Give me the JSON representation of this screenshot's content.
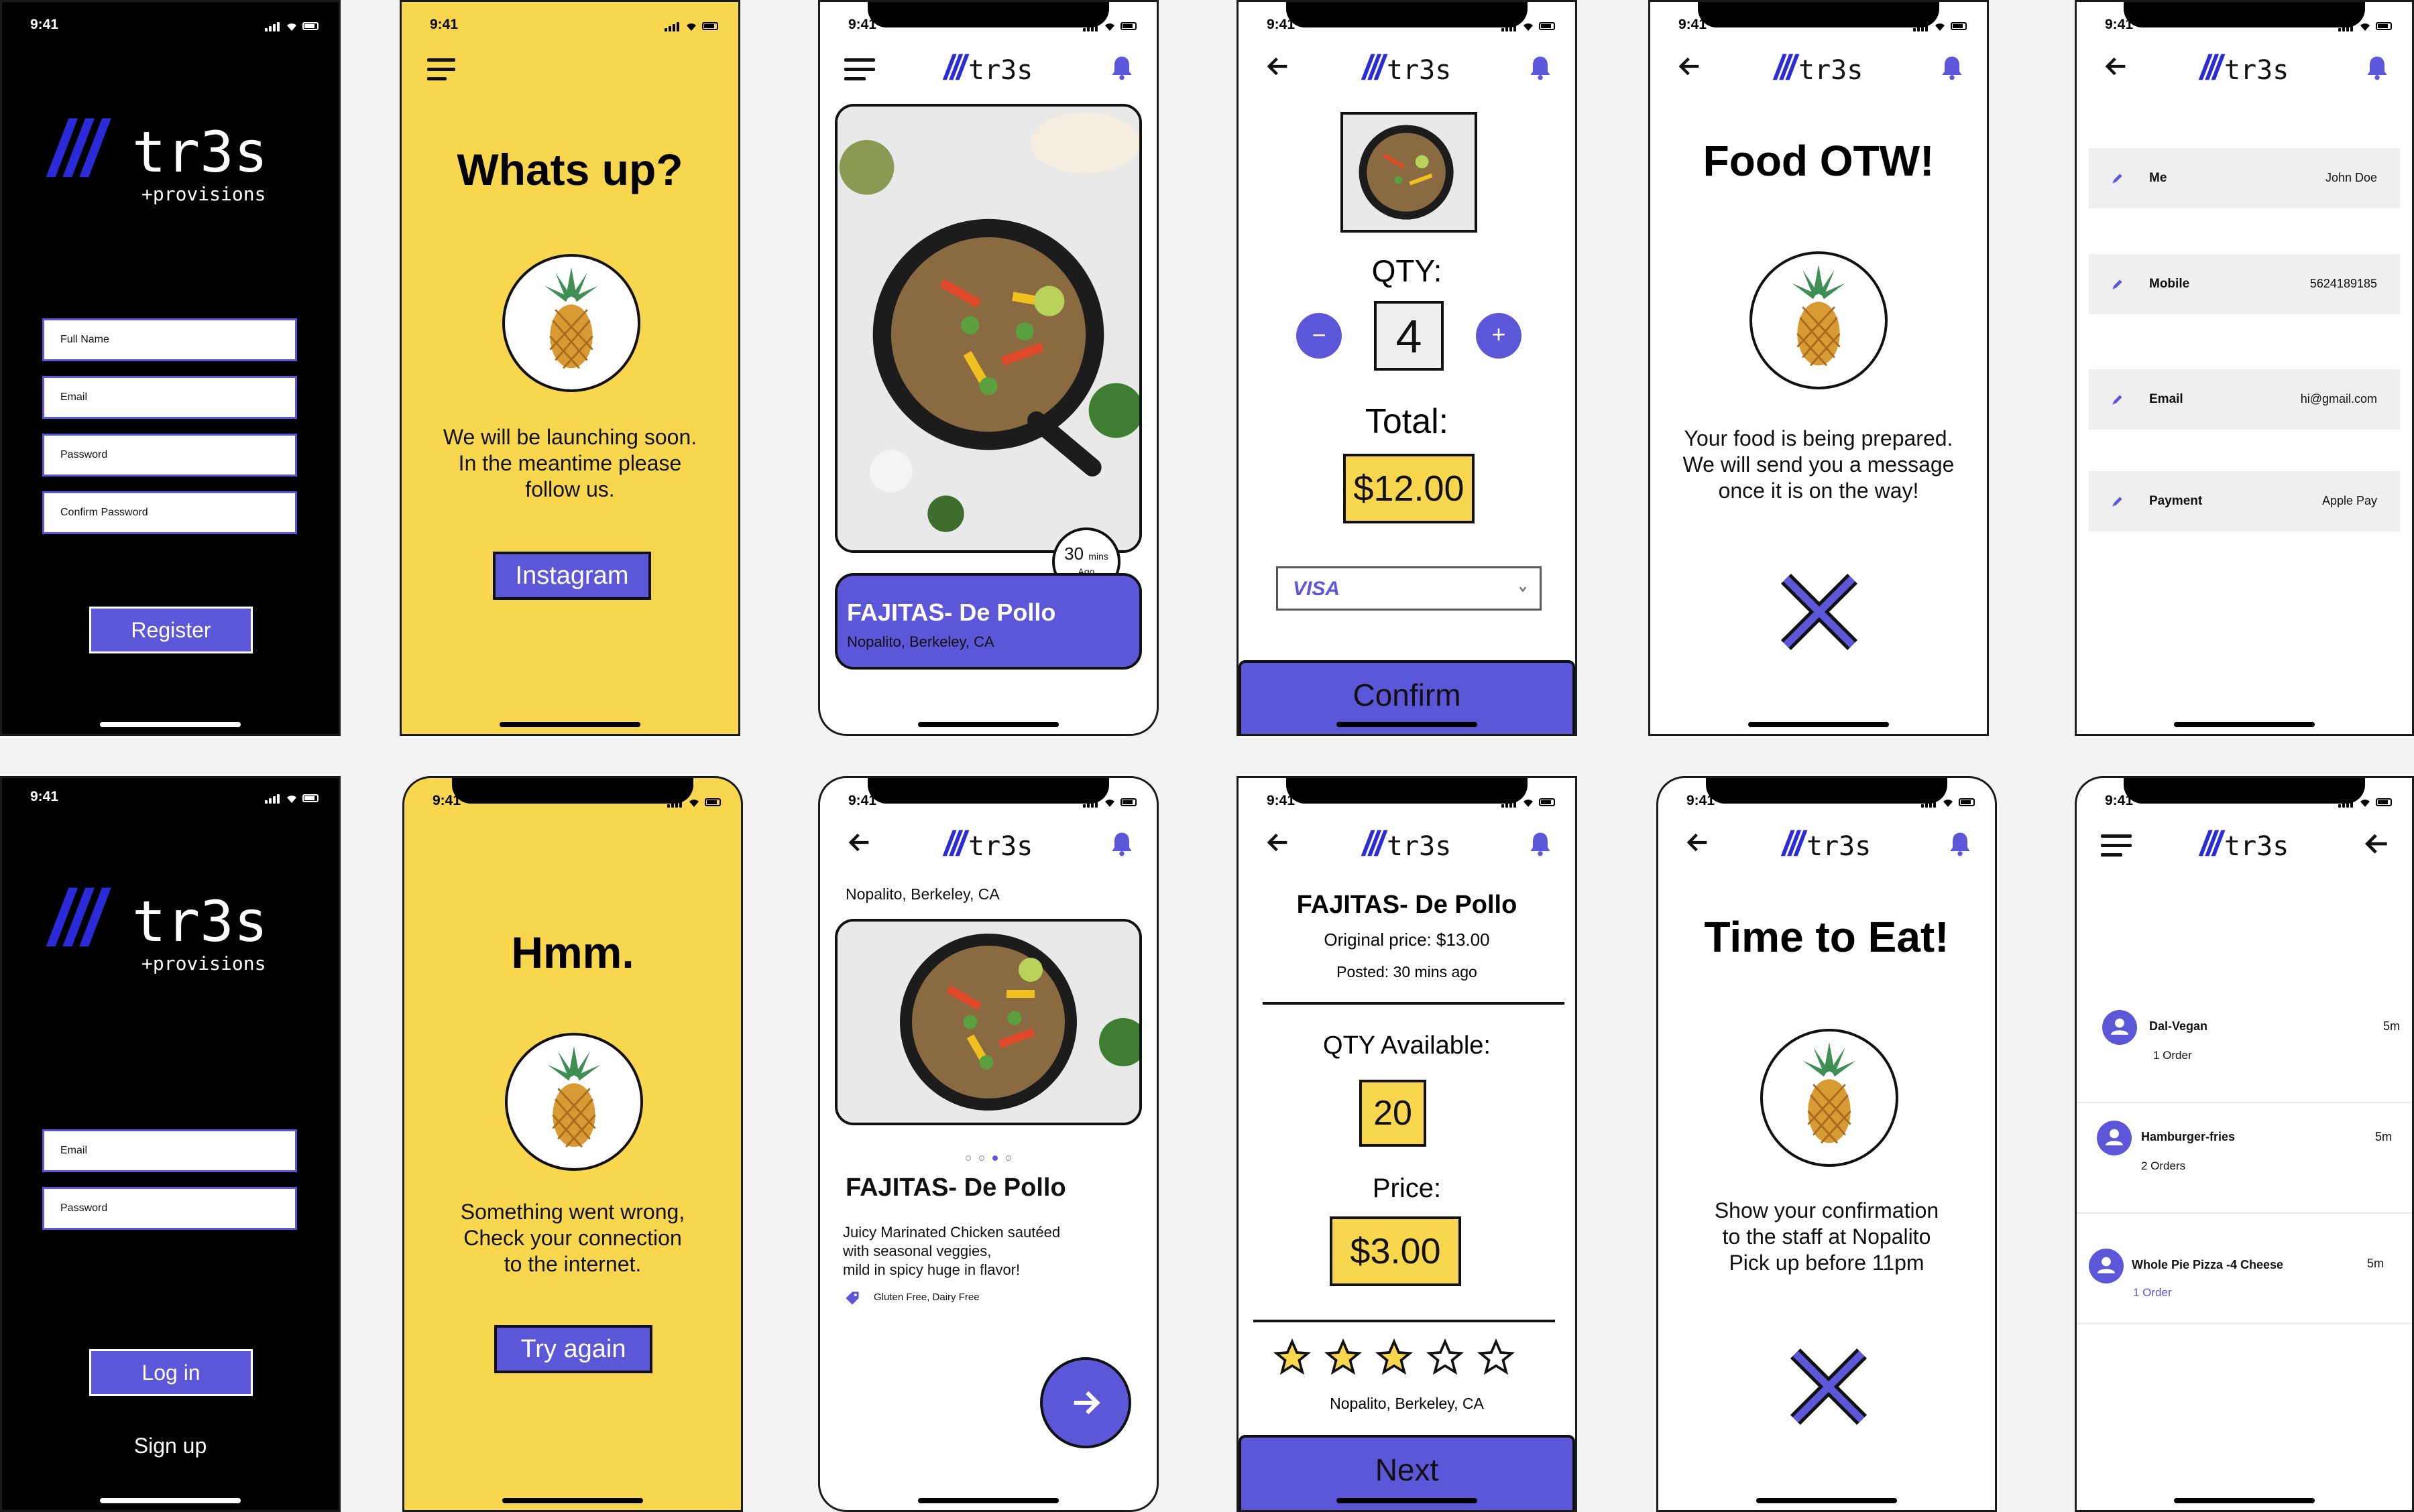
{
  "status_time": "9:41",
  "brand": {
    "slashes": "///",
    "word": "tr3s",
    "sub": "+provisions"
  },
  "register": {
    "fields": [
      "Full Name",
      "Email",
      "Password",
      "Confirm Password"
    ],
    "button": "Register"
  },
  "login": {
    "fields": [
      "Email",
      "Password"
    ],
    "button": "Log in",
    "signup": "Sign up"
  },
  "launch": {
    "title": "Whats up?",
    "message_lines": [
      "We will be launching soon.",
      "In the meantime please",
      "follow us."
    ],
    "button": "Instagram"
  },
  "error": {
    "title": "Hmm.",
    "message_lines": [
      "Something went wrong,",
      "Check your connection",
      "to the internet."
    ],
    "button": "Try again"
  },
  "feed": {
    "badge_num": "30",
    "badge_unit": "mins",
    "badge_ago": "Ago",
    "title": "FAJITAS- De Pollo",
    "location": "Nopalito, Berkeley, CA"
  },
  "detail": {
    "location": "Nopalito, Berkeley, CA",
    "title": "FAJITAS- De Pollo",
    "desc_lines": [
      "Juicy Marinated Chicken sautéed",
      "with seasonal veggies,",
      "mild in spicy huge in flavor!"
    ],
    "tags": "Gluten Free, Dairy Free",
    "dots_total": 4,
    "dots_active": 3
  },
  "order": {
    "qty_label": "QTY:",
    "qty": "4",
    "minus": "−",
    "plus": "+",
    "total_label": "Total:",
    "total": "$12.00",
    "payment": "VISA",
    "button": "Confirm"
  },
  "listing": {
    "title": "FAJITAS- De Pollo",
    "original_price": "Original price: $13.00",
    "posted": "Posted: 30 mins ago",
    "qty_label": "QTY Available:",
    "qty": "20",
    "price_label": "Price:",
    "price": "$3.00",
    "rating_filled": 3,
    "rating_total": 5,
    "location": "Nopalito, Berkeley, CA",
    "button": "Next"
  },
  "otw": {
    "title": "Food OTW!",
    "message_lines": [
      "Your food is being prepared.",
      "We will send you a message",
      "once it is on the way!"
    ]
  },
  "eat": {
    "title": "Time to Eat!",
    "message_lines": [
      "Show your confirmation",
      "to the staff at Nopalito",
      "Pick up before 11pm"
    ]
  },
  "profile": {
    "rows": [
      {
        "key": "Me",
        "value": "John Doe"
      },
      {
        "key": "Mobile",
        "value": "5624189185"
      },
      {
        "key": "Email",
        "value": "hi@gmail.com"
      },
      {
        "key": "Payment",
        "value": "Apple Pay"
      }
    ]
  },
  "orders": {
    "items": [
      {
        "name": "Dal-Vegan",
        "count": "1 Order",
        "time": "5m"
      },
      {
        "name": "Hamburger-fries",
        "count": "2 Orders",
        "time": "5m"
      },
      {
        "name": "Whole Pie Pizza -4 Cheese",
        "count": "1 Order",
        "time": "5m"
      }
    ]
  },
  "colors": {
    "accent": "#5c57d9",
    "brand_blue": "#2b2bd9",
    "yellow": "#f8d64e",
    "dark": "#000000"
  }
}
